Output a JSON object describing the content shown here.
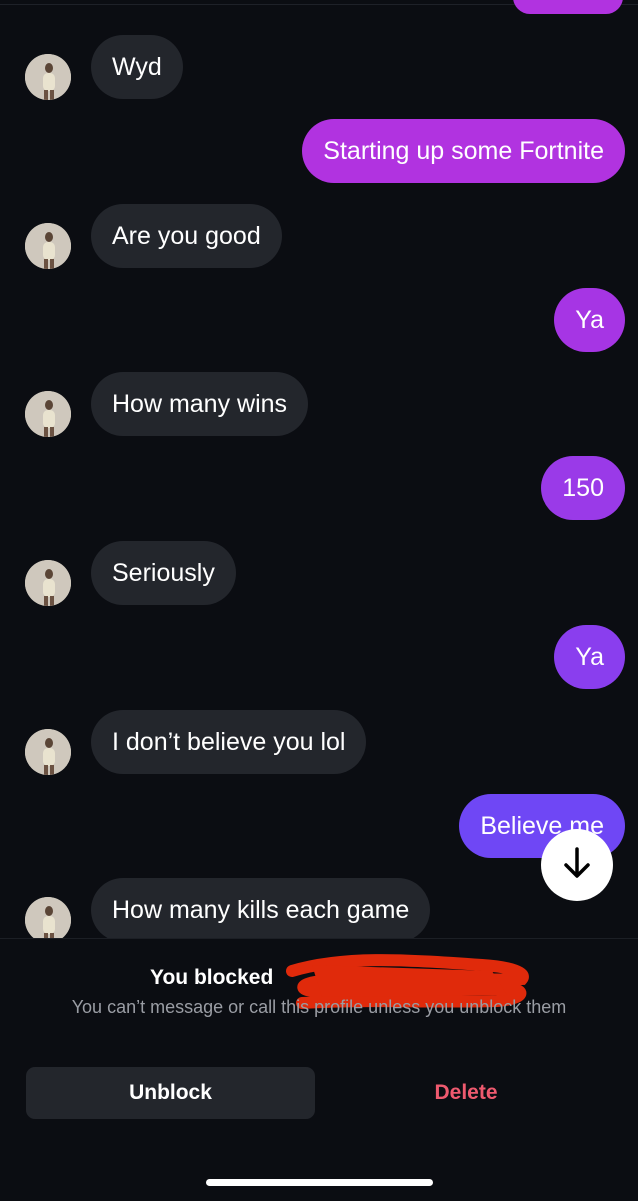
{
  "colors": {
    "background": "#0b0d12",
    "incoming_bubble": "#23262c",
    "outgoing_gradient_top": "#b133e0",
    "outgoing_gradient_bottom": "#6f47f5",
    "delete_text": "#ef5a6f"
  },
  "messages": [
    {
      "direction": "incoming",
      "text": "Wyd"
    },
    {
      "direction": "outgoing",
      "text": "Starting up some Fortnite"
    },
    {
      "direction": "incoming",
      "text": "Are you good"
    },
    {
      "direction": "outgoing",
      "text": "Ya"
    },
    {
      "direction": "incoming",
      "text": "How many wins"
    },
    {
      "direction": "outgoing",
      "text": "150"
    },
    {
      "direction": "incoming",
      "text": "Seriously"
    },
    {
      "direction": "outgoing",
      "text": "Ya"
    },
    {
      "direction": "incoming",
      "text": "I don’t believe you lol"
    },
    {
      "direction": "outgoing",
      "text": "Believe me"
    },
    {
      "direction": "incoming",
      "text": "How many kills each game"
    }
  ],
  "scroll_button": {
    "icon": "arrow-down-icon"
  },
  "blocked_banner": {
    "title": "You blocked",
    "description": "You can’t message or call this profile unless you unblock them",
    "unblock_label": "Unblock",
    "delete_label": "Delete"
  }
}
